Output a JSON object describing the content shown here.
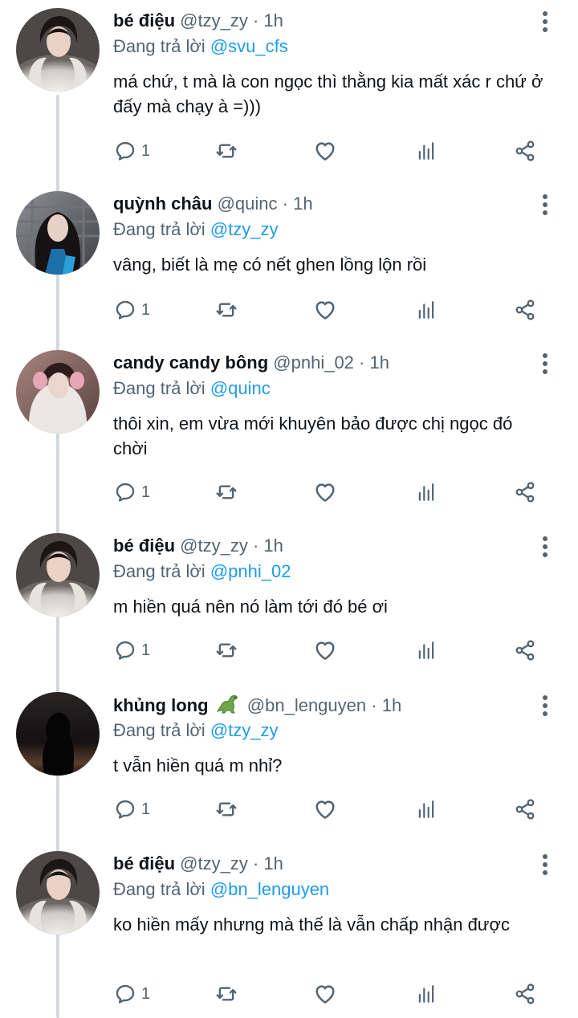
{
  "labels": {
    "reply_prefix": "Đang trả lời",
    "separator": "·"
  },
  "colors": {
    "text": "#0f1419",
    "secondary": "#536471",
    "link": "#1d9bf0",
    "thread_line": "#cfd9de"
  },
  "tweets": [
    {
      "name": "bé điệu",
      "handle": "@tzy_zy",
      "time": "1h",
      "reply_to": "@svu_cfs",
      "text": "má chứ, t mà là con ngọc thì thằng kia mất xác r chứ ở đấy mà chạy à =)))",
      "reply_count": "1",
      "icons": [
        "reply-icon",
        "retweet-icon",
        "like-icon",
        "analytics-icon",
        "share-icon",
        "more-icon"
      ]
    },
    {
      "name": "quỳnh châu",
      "handle": "@quinc",
      "time": "1h",
      "reply_to": "@tzy_zy",
      "text": "vâng, biết là mẹ có nết ghen lồng lộn rồi",
      "reply_count": "1"
    },
    {
      "name": "candy candy bông",
      "handle": "@pnhi_02",
      "time": "1h",
      "reply_to": "@quinc",
      "text": "thôi xin, em vừa mới khuyên bảo được chị ngọc đó chời",
      "reply_count": "1"
    },
    {
      "name": "bé điệu",
      "handle": "@tzy_zy",
      "time": "1h",
      "reply_to": "@pnhi_02",
      "text": "m hiền quá nên nó làm tới đó bé ơi",
      "reply_count": "1"
    },
    {
      "name": "khủng long",
      "handle": "@bn_lenguyen",
      "time": "1h",
      "reply_to": "@tzy_zy",
      "text": "t vẫn hiền quá m nhỉ?",
      "reply_count": "1",
      "name_emoji": "dinosaur-icon"
    },
    {
      "name": "bé điệu",
      "handle": "@tzy_zy",
      "time": "1h",
      "reply_to": "@bn_lenguyen",
      "text": "ko hiền mấy nhưng mà thế là vẫn chấp nhận được",
      "reply_count": "1"
    }
  ]
}
